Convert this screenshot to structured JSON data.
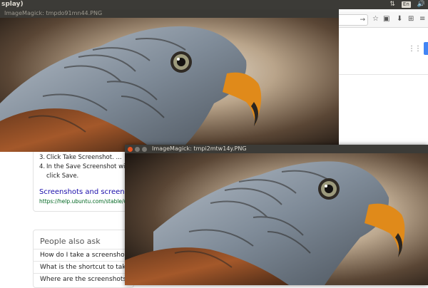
{
  "top_panel": {
    "app_title": "splay)",
    "tray": {
      "network_icon": "⇅",
      "keyboard_label": "En",
      "volume_icon": "🔊"
    }
  },
  "browser": {
    "go_glyph": "→",
    "toolbar_icons": [
      "☆",
      "▣",
      "⬇",
      "⊞",
      "≡"
    ],
    "apps_icon": "⋮⋮⋮",
    "result": {
      "steps": [
        {
          "num": "3.",
          "text": "Click Take Screenshot. ..."
        },
        {
          "num": "4.",
          "text": "In the Save Screenshot wind"
        },
        {
          "num": "",
          "text": "click Save."
        }
      ],
      "link": "Screenshots and screencast",
      "url": "https://help.ubuntu.com/stable/ubun"
    },
    "people_also_ask": {
      "title": "People also ask",
      "questions": [
        "How do I take a screenshot",
        "What is the shortcut to take",
        "Where are the screenshots s"
      ]
    }
  },
  "windows": [
    {
      "title": "ImageMagick: tmpdo91mn44.PNG"
    },
    {
      "title": "ImageMagick: tmpi2mtw14y.PNG"
    }
  ],
  "colors": {
    "close": "#e95420",
    "other": "#7a7873",
    "link": "#1a0dab",
    "url": "#006621"
  }
}
